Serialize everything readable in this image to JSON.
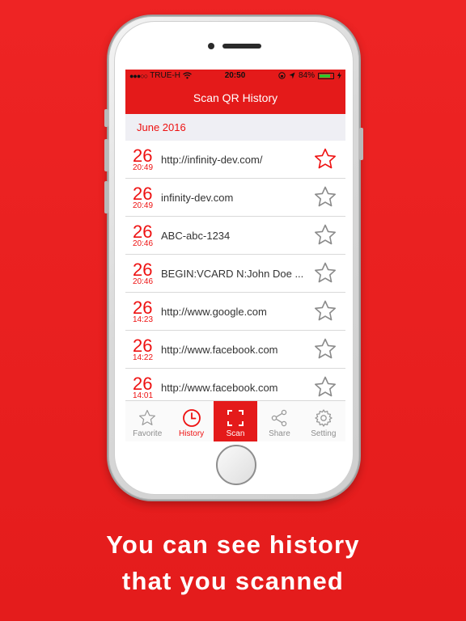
{
  "status_bar": {
    "carrier": "TRUE-H",
    "time": "20:50",
    "battery": "84%",
    "battery_level": 0.84
  },
  "nav": {
    "title": "Scan QR History"
  },
  "section": {
    "title": "June 2016"
  },
  "history": [
    {
      "day": "26",
      "time": "20:49",
      "text": "http://infinity-dev.com/",
      "favorite": true
    },
    {
      "day": "26",
      "time": "20:49",
      "text": "infinity-dev.com",
      "favorite": false
    },
    {
      "day": "26",
      "time": "20:46",
      "text": "ABC-abc-1234",
      "favorite": false
    },
    {
      "day": "26",
      "time": "20:46",
      "text": "BEGIN:VCARD N:John Doe ...",
      "favorite": false
    },
    {
      "day": "26",
      "time": "14:23",
      "text": "http://www.google.com",
      "favorite": false
    },
    {
      "day": "26",
      "time": "14:22",
      "text": "http://www.facebook.com",
      "favorite": false
    },
    {
      "day": "26",
      "time": "14:01",
      "text": "http://www.facebook.com",
      "favorite": false
    }
  ],
  "tabs": [
    {
      "label": "Favorite",
      "icon": "star-icon"
    },
    {
      "label": "History",
      "icon": "clock-icon"
    },
    {
      "label": "Scan",
      "icon": "scan-frame-icon"
    },
    {
      "label": "Share",
      "icon": "share-icon"
    },
    {
      "label": "Setting",
      "icon": "gear-icon"
    }
  ],
  "caption": {
    "line1": "You can see history",
    "line2": "that you scanned"
  },
  "colors": {
    "accent": "#e41a1a",
    "background": "#ee2424",
    "battery": "#2ec52e"
  }
}
